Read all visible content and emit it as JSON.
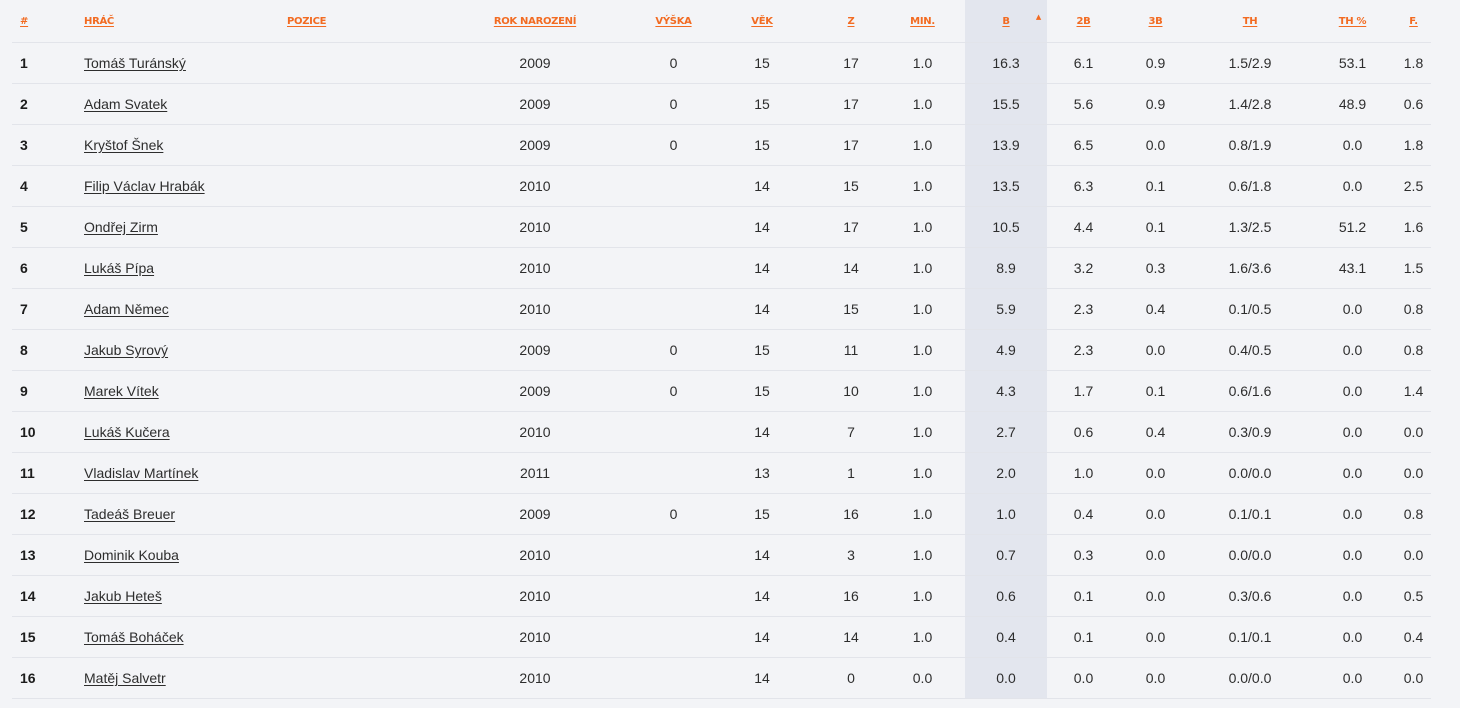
{
  "headers": {
    "rank": "#",
    "player": "Hráč",
    "position": "Pozice",
    "birth_year": "Rok narození",
    "height": "Výška",
    "age": "Věk",
    "games": "Z",
    "minutes": "Min.",
    "points": "B",
    "two_pt": "2B",
    "three_pt": "3B",
    "free_throws": "TH",
    "ft_pct": "TH %",
    "fouls": "F."
  },
  "sorted_column": "points",
  "sort_icon": "sort-desc-icon",
  "accent_color": "#f26b22",
  "rows": [
    {
      "rank": "1",
      "player": "Tomáš Turánský",
      "position": "",
      "birth_year": "2009",
      "height": "0",
      "age": "15",
      "games": "17",
      "minutes": "1.0",
      "points": "16.3",
      "two_pt": "6.1",
      "three_pt": "0.9",
      "free_throws": "1.5/2.9",
      "ft_pct": "53.1",
      "fouls": "1.8"
    },
    {
      "rank": "2",
      "player": "Adam Svatek",
      "position": "",
      "birth_year": "2009",
      "height": "0",
      "age": "15",
      "games": "17",
      "minutes": "1.0",
      "points": "15.5",
      "two_pt": "5.6",
      "three_pt": "0.9",
      "free_throws": "1.4/2.8",
      "ft_pct": "48.9",
      "fouls": "0.6"
    },
    {
      "rank": "3",
      "player": "Kryštof Šnek",
      "position": "",
      "birth_year": "2009",
      "height": "0",
      "age": "15",
      "games": "17",
      "minutes": "1.0",
      "points": "13.9",
      "two_pt": "6.5",
      "three_pt": "0.0",
      "free_throws": "0.8/1.9",
      "ft_pct": "0.0",
      "fouls": "1.8"
    },
    {
      "rank": "4",
      "player": "Filip Václav Hrabák",
      "position": "",
      "birth_year": "2010",
      "height": "",
      "age": "14",
      "games": "15",
      "minutes": "1.0",
      "points": "13.5",
      "two_pt": "6.3",
      "three_pt": "0.1",
      "free_throws": "0.6/1.8",
      "ft_pct": "0.0",
      "fouls": "2.5"
    },
    {
      "rank": "5",
      "player": "Ondřej Zirm",
      "position": "",
      "birth_year": "2010",
      "height": "",
      "age": "14",
      "games": "17",
      "minutes": "1.0",
      "points": "10.5",
      "two_pt": "4.4",
      "three_pt": "0.1",
      "free_throws": "1.3/2.5",
      "ft_pct": "51.2",
      "fouls": "1.6"
    },
    {
      "rank": "6",
      "player": "Lukáš Pípa",
      "position": "",
      "birth_year": "2010",
      "height": "",
      "age": "14",
      "games": "14",
      "minutes": "1.0",
      "points": "8.9",
      "two_pt": "3.2",
      "three_pt": "0.3",
      "free_throws": "1.6/3.6",
      "ft_pct": "43.1",
      "fouls": "1.5"
    },
    {
      "rank": "7",
      "player": "Adam Němec",
      "position": "",
      "birth_year": "2010",
      "height": "",
      "age": "14",
      "games": "15",
      "minutes": "1.0",
      "points": "5.9",
      "two_pt": "2.3",
      "three_pt": "0.4",
      "free_throws": "0.1/0.5",
      "ft_pct": "0.0",
      "fouls": "0.8"
    },
    {
      "rank": "8",
      "player": "Jakub Syrový",
      "position": "",
      "birth_year": "2009",
      "height": "0",
      "age": "15",
      "games": "11",
      "minutes": "1.0",
      "points": "4.9",
      "two_pt": "2.3",
      "three_pt": "0.0",
      "free_throws": "0.4/0.5",
      "ft_pct": "0.0",
      "fouls": "0.8"
    },
    {
      "rank": "9",
      "player": "Marek Vítek",
      "position": "",
      "birth_year": "2009",
      "height": "0",
      "age": "15",
      "games": "10",
      "minutes": "1.0",
      "points": "4.3",
      "two_pt": "1.7",
      "three_pt": "0.1",
      "free_throws": "0.6/1.6",
      "ft_pct": "0.0",
      "fouls": "1.4"
    },
    {
      "rank": "10",
      "player": "Lukáš Kučera",
      "position": "",
      "birth_year": "2010",
      "height": "",
      "age": "14",
      "games": "7",
      "minutes": "1.0",
      "points": "2.7",
      "two_pt": "0.6",
      "three_pt": "0.4",
      "free_throws": "0.3/0.9",
      "ft_pct": "0.0",
      "fouls": "0.0"
    },
    {
      "rank": "11",
      "player": "Vladislav Martínek",
      "position": "",
      "birth_year": "2011",
      "height": "",
      "age": "13",
      "games": "1",
      "minutes": "1.0",
      "points": "2.0",
      "two_pt": "1.0",
      "three_pt": "0.0",
      "free_throws": "0.0/0.0",
      "ft_pct": "0.0",
      "fouls": "0.0"
    },
    {
      "rank": "12",
      "player": "Tadeáš Breuer",
      "position": "",
      "birth_year": "2009",
      "height": "0",
      "age": "15",
      "games": "16",
      "minutes": "1.0",
      "points": "1.0",
      "two_pt": "0.4",
      "three_pt": "0.0",
      "free_throws": "0.1/0.1",
      "ft_pct": "0.0",
      "fouls": "0.8"
    },
    {
      "rank": "13",
      "player": "Dominik Kouba",
      "position": "",
      "birth_year": "2010",
      "height": "",
      "age": "14",
      "games": "3",
      "minutes": "1.0",
      "points": "0.7",
      "two_pt": "0.3",
      "three_pt": "0.0",
      "free_throws": "0.0/0.0",
      "ft_pct": "0.0",
      "fouls": "0.0"
    },
    {
      "rank": "14",
      "player": "Jakub Heteš",
      "position": "",
      "birth_year": "2010",
      "height": "",
      "age": "14",
      "games": "16",
      "minutes": "1.0",
      "points": "0.6",
      "two_pt": "0.1",
      "three_pt": "0.0",
      "free_throws": "0.3/0.6",
      "ft_pct": "0.0",
      "fouls": "0.5"
    },
    {
      "rank": "15",
      "player": "Tomáš Boháček",
      "position": "",
      "birth_year": "2010",
      "height": "",
      "age": "14",
      "games": "14",
      "minutes": "1.0",
      "points": "0.4",
      "two_pt": "0.1",
      "three_pt": "0.0",
      "free_throws": "0.1/0.1",
      "ft_pct": "0.0",
      "fouls": "0.4"
    },
    {
      "rank": "16",
      "player": "Matěj Salvetr",
      "position": "",
      "birth_year": "2010",
      "height": "",
      "age": "14",
      "games": "0",
      "minutes": "0.0",
      "points": "0.0",
      "two_pt": "0.0",
      "three_pt": "0.0",
      "free_throws": "0.0/0.0",
      "ft_pct": "0.0",
      "fouls": "0.0"
    }
  ]
}
